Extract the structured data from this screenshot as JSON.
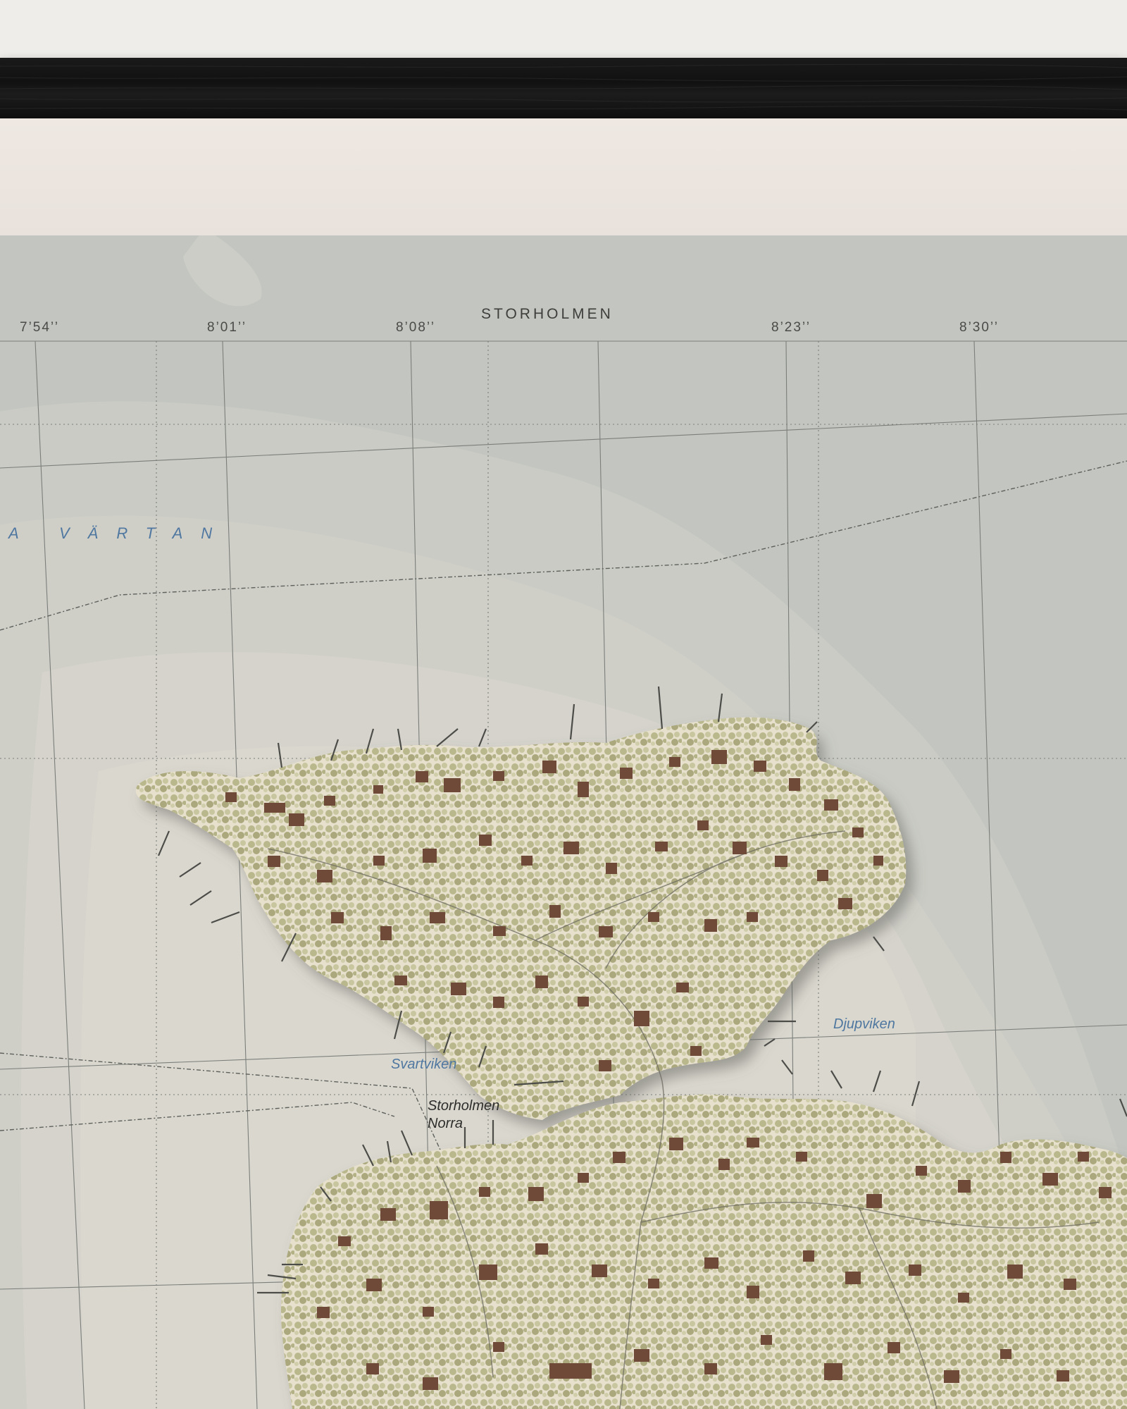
{
  "map_title": "STORHOLMEN",
  "coordinates": [
    "7’54’’",
    "8’01’’",
    "8’08’’",
    "8’23’’",
    "8’30’’"
  ],
  "water_labels": {
    "bay_north": "A   VÄRTAN",
    "svartviken": "Svartviken",
    "djupviken": "Djupviken"
  },
  "place_labels": {
    "storholmen_norra_line1": "Storholmen",
    "storholmen_norra_line2": "Norra"
  },
  "colors": {
    "water": "#c3c6c0",
    "land": "#e7e2cf",
    "forest": "#b7b68c",
    "building": "#6f4a38",
    "label_water": "#4f77a0",
    "frame": "#141414",
    "mat": "#ece5df"
  }
}
